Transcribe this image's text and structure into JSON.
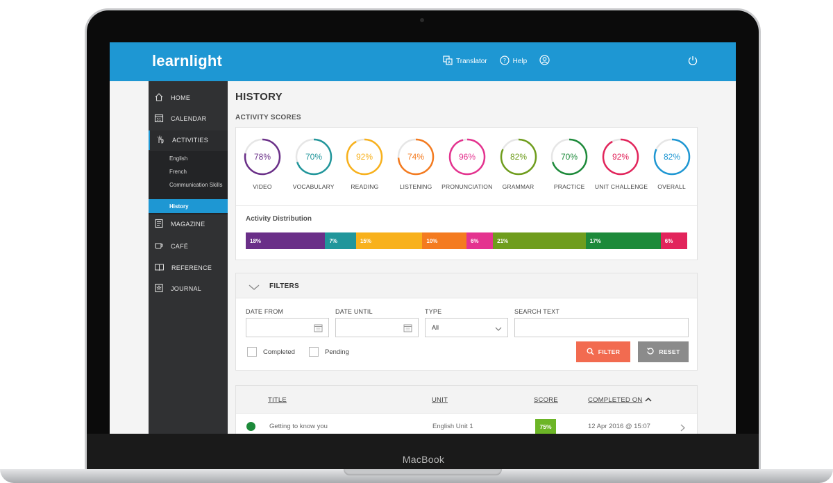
{
  "device": {
    "brand": "MacBook"
  },
  "topbar": {
    "logo": "learnlight",
    "translator": "Translator",
    "help": "Help",
    "color": "#1e97d3"
  },
  "sidebar": {
    "items": [
      {
        "label": "HOME",
        "icon": "home-icon"
      },
      {
        "label": "CALENDAR",
        "icon": "calendar-icon"
      },
      {
        "label": "ACTIVITIES",
        "icon": "pointer-icon"
      },
      {
        "label": "MAGAZINE",
        "icon": "magazine-icon"
      },
      {
        "label": "CAFÉ",
        "icon": "coffee-icon"
      },
      {
        "label": "REFERENCE",
        "icon": "book-icon"
      },
      {
        "label": "JOURNAL",
        "icon": "journal-icon"
      }
    ],
    "calendar_day": "31",
    "subitems": [
      {
        "label": "English"
      },
      {
        "label": "French"
      },
      {
        "label": "Communication Skills"
      },
      {
        "label": "History"
      }
    ]
  },
  "main": {
    "title": "HISTORY",
    "scores_title": "ACTIVITY SCORES",
    "scores": [
      {
        "label": "VIDEO",
        "value": "78%",
        "pct": 78,
        "color": "#6a2f88"
      },
      {
        "label": "VOCABULARY",
        "value": "70%",
        "pct": 70,
        "color": "#21969b"
      },
      {
        "label": "READING",
        "value": "92%",
        "pct": 92,
        "color": "#f8b11c"
      },
      {
        "label": "LISTENING",
        "value": "74%",
        "pct": 74,
        "color": "#f47b20"
      },
      {
        "label": "PRONUNCIATION",
        "value": "96%",
        "pct": 96,
        "color": "#e4338f"
      },
      {
        "label": "GRAMMAR",
        "value": "82%",
        "pct": 82,
        "color": "#6f9d1d"
      },
      {
        "label": "PRACTICE",
        "value": "70%",
        "pct": 70,
        "color": "#1d8a3a"
      },
      {
        "label": "UNIT CHALLENGE",
        "value": "92%",
        "pct": 92,
        "color": "#e2245b"
      },
      {
        "label": "OVERALL",
        "value": "82%",
        "pct": 82,
        "color": "#1e97d3"
      }
    ],
    "distribution_title": "Activity Distribution",
    "distribution": [
      {
        "label": "18%",
        "pct": 18,
        "color": "#6a2f88"
      },
      {
        "label": "7%",
        "pct": 7,
        "color": "#21969b"
      },
      {
        "label": "15%",
        "pct": 15,
        "color": "#f8b11c"
      },
      {
        "label": "10%",
        "pct": 10,
        "color": "#f47b20"
      },
      {
        "label": "6%",
        "pct": 6,
        "color": "#e4338f"
      },
      {
        "label": "21%",
        "pct": 21,
        "color": "#6f9d1d"
      },
      {
        "label": "17%",
        "pct": 17,
        "color": "#1d8a3a"
      },
      {
        "label": "6%",
        "pct": 6,
        "color": "#e2245b"
      }
    ]
  },
  "filters": {
    "title": "FILTERS",
    "date_from_label": "DATE FROM",
    "date_until_label": "DATE UNTIL",
    "type_label": "TYPE",
    "type_value": "All",
    "search_label": "SEARCH TEXT",
    "completed_label": "Completed",
    "pending_label": "Pending",
    "filter_button": "FILTER",
    "reset_button": "RESET",
    "filter_color": "#f26b50",
    "reset_color": "#8b8b8b"
  },
  "table": {
    "headers": {
      "title": "TITLE",
      "unit": "UNIT",
      "score": "SCORE",
      "completed": "COMPLETED ON"
    },
    "rows": [
      {
        "title": "Getting to know you",
        "unit": "English Unit 1",
        "score": "75%",
        "completed": "12 Apr 2016 @ 15:07"
      }
    ]
  }
}
